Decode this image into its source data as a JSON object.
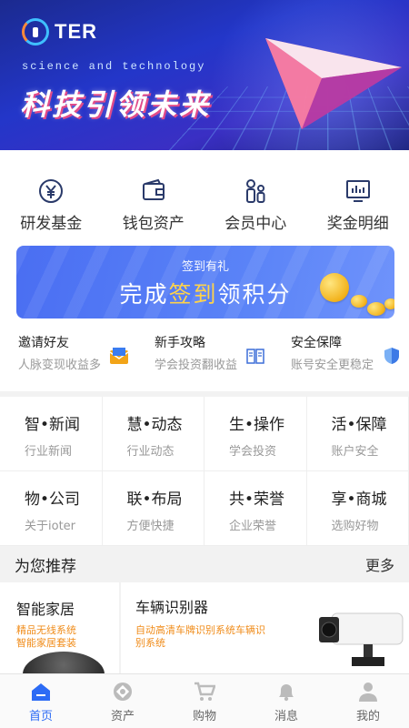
{
  "banner": {
    "logo_text": "TER",
    "tagline": "science and technology",
    "slogan": "科技引领未来"
  },
  "menu": [
    {
      "label": "研发基金",
      "icon": "yen-coin-icon"
    },
    {
      "label": "钱包资产",
      "icon": "wallet-icon"
    },
    {
      "label": "会员中心",
      "icon": "members-icon"
    },
    {
      "label": "奖金明细",
      "icon": "bar-chart-monitor-icon"
    }
  ],
  "sign_banner": {
    "small": "签到有礼",
    "big_pre": "完成",
    "big_highlight": "签到",
    "big_post": "领积分"
  },
  "links": [
    {
      "title": "邀请好友",
      "subtitle": "人脉变现收益多",
      "icon": "envelope-icon"
    },
    {
      "title": "新手攻略",
      "subtitle": "学会投资翻收益",
      "icon": "book-icon"
    },
    {
      "title": "安全保障",
      "subtitle": "账号安全更稳定",
      "icon": "shield-icon"
    }
  ],
  "categories": [
    {
      "title": "智•新闻",
      "subtitle": "行业新闻"
    },
    {
      "title": "慧•动态",
      "subtitle": "行业动态"
    },
    {
      "title": "生•操作",
      "subtitle": "学会投资"
    },
    {
      "title": "活•保障",
      "subtitle": "账户安全"
    },
    {
      "title": "物•公司",
      "subtitle": "关于ioter"
    },
    {
      "title": "联•布局",
      "subtitle": "方便快捷"
    },
    {
      "title": "共•荣誉",
      "subtitle": "企业荣誉"
    },
    {
      "title": "享•商城",
      "subtitle": "选购好物"
    }
  ],
  "recommend": {
    "title": "为您推荐",
    "more": "更多",
    "left": {
      "title": "智能家居",
      "subtitle": "精品无线系统\n智能家居套装"
    },
    "right": {
      "title": "车辆识别器",
      "subtitle": "自动高清车牌识别系统车辆识别系统"
    }
  },
  "tabs": [
    {
      "label": "首页",
      "icon": "home-icon",
      "active": true
    },
    {
      "label": "资产",
      "icon": "asset-icon",
      "active": false
    },
    {
      "label": "购物",
      "icon": "cart-icon",
      "active": false
    },
    {
      "label": "消息",
      "icon": "bell-icon",
      "active": false
    },
    {
      "label": "我的",
      "icon": "user-icon",
      "active": false
    }
  ],
  "colors": {
    "accent": "#2c6bf5",
    "banner_bg": "#2336c9",
    "highlight": "#ffd34a",
    "orange": "#f08c1a"
  }
}
